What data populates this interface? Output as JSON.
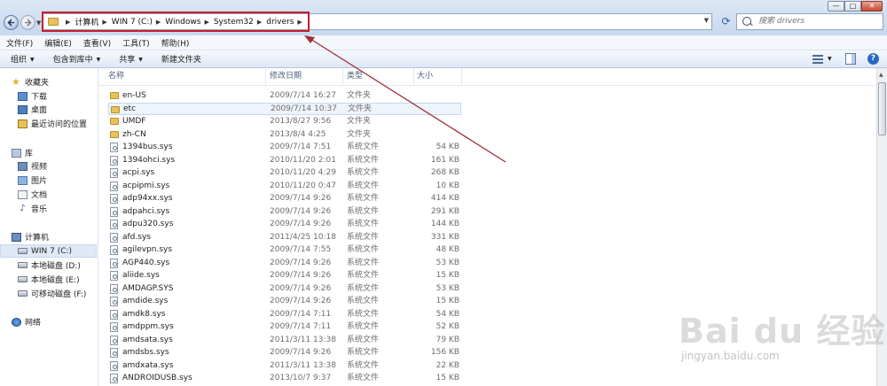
{
  "window": {
    "min_symbol": "—",
    "max_symbol": "□",
    "close_symbol": "✕"
  },
  "address": {
    "segments": [
      "计算机",
      "WIN 7 (C:)",
      "Windows",
      "System32",
      "drivers"
    ]
  },
  "search": {
    "placeholder": "搜索 drivers"
  },
  "menu": [
    "文件(F)",
    "编辑(E)",
    "查看(V)",
    "工具(T)",
    "帮助(H)"
  ],
  "toolbar": {
    "organize": "组织",
    "include_library": "包含到库中",
    "share": "共享",
    "new_folder": "新建文件夹"
  },
  "nav": {
    "favorites": "收藏夹",
    "downloads": "下载",
    "desktop": "桌面",
    "recent": "最近访问的位置",
    "libraries": "库",
    "videos": "视频",
    "pictures": "图片",
    "documents": "文档",
    "music": "音乐",
    "computer": "计算机",
    "drive_c": "WIN 7 (C:)",
    "drive_d": "本地磁盘 (D:)",
    "drive_e": "本地磁盘 (E:)",
    "drive_f": "可移动磁盘 (F:)",
    "network": "网络"
  },
  "columns": {
    "name": "名称",
    "date": "修改日期",
    "type": "类型",
    "size": "大小"
  },
  "files": [
    {
      "name": "en-US",
      "date": "2009/7/14 16:27",
      "type": "文件夹",
      "size": "",
      "kind": "folder"
    },
    {
      "name": "etc",
      "date": "2009/7/14 10:37",
      "type": "文件夹",
      "size": "",
      "kind": "folder"
    },
    {
      "name": "UMDF",
      "date": "2013/8/27 9:56",
      "type": "文件夹",
      "size": "",
      "kind": "folder"
    },
    {
      "name": "zh-CN",
      "date": "2013/8/4 4:25",
      "type": "文件夹",
      "size": "",
      "kind": "folder"
    },
    {
      "name": "1394bus.sys",
      "date": "2009/7/14 7:51",
      "type": "系统文件",
      "size": "54 KB",
      "kind": "sys"
    },
    {
      "name": "1394ohci.sys",
      "date": "2010/11/20 2:01",
      "type": "系统文件",
      "size": "161 KB",
      "kind": "sys"
    },
    {
      "name": "acpi.sys",
      "date": "2010/11/20 4:29",
      "type": "系统文件",
      "size": "268 KB",
      "kind": "sys"
    },
    {
      "name": "acpipmi.sys",
      "date": "2010/11/20 0:47",
      "type": "系统文件",
      "size": "10 KB",
      "kind": "sys"
    },
    {
      "name": "adp94xx.sys",
      "date": "2009/7/14 9:26",
      "type": "系统文件",
      "size": "414 KB",
      "kind": "sys"
    },
    {
      "name": "adpahci.sys",
      "date": "2009/7/14 9:26",
      "type": "系统文件",
      "size": "291 KB",
      "kind": "sys"
    },
    {
      "name": "adpu320.sys",
      "date": "2009/7/14 9:26",
      "type": "系统文件",
      "size": "144 KB",
      "kind": "sys"
    },
    {
      "name": "afd.sys",
      "date": "2011/4/25 10:18",
      "type": "系统文件",
      "size": "331 KB",
      "kind": "sys"
    },
    {
      "name": "agilevpn.sys",
      "date": "2009/7/14 7:55",
      "type": "系统文件",
      "size": "48 KB",
      "kind": "sys"
    },
    {
      "name": "AGP440.sys",
      "date": "2009/7/14 9:26",
      "type": "系统文件",
      "size": "53 KB",
      "kind": "sys"
    },
    {
      "name": "aliide.sys",
      "date": "2009/7/14 9:26",
      "type": "系统文件",
      "size": "15 KB",
      "kind": "sys"
    },
    {
      "name": "AMDAGP.SYS",
      "date": "2009/7/14 9:26",
      "type": "系统文件",
      "size": "53 KB",
      "kind": "sys"
    },
    {
      "name": "amdide.sys",
      "date": "2009/7/14 9:26",
      "type": "系统文件",
      "size": "15 KB",
      "kind": "sys"
    },
    {
      "name": "amdk8.sys",
      "date": "2009/7/14 7:11",
      "type": "系统文件",
      "size": "54 KB",
      "kind": "sys"
    },
    {
      "name": "amdppm.sys",
      "date": "2009/7/14 7:11",
      "type": "系统文件",
      "size": "52 KB",
      "kind": "sys"
    },
    {
      "name": "amdsata.sys",
      "date": "2011/3/11 13:38",
      "type": "系统文件",
      "size": "79 KB",
      "kind": "sys"
    },
    {
      "name": "amdsbs.sys",
      "date": "2009/7/14 9:26",
      "type": "系统文件",
      "size": "156 KB",
      "kind": "sys"
    },
    {
      "name": "amdxata.sys",
      "date": "2011/3/11 13:38",
      "type": "系统文件",
      "size": "22 KB",
      "kind": "sys"
    },
    {
      "name": "ANDROIDUSB.sys",
      "date": "2013/10/7 9:37",
      "type": "系统文件",
      "size": "15 KB",
      "kind": "sys"
    }
  ],
  "watermark": {
    "main": "Bai du 经验",
    "sub": "jingyan.baidu.com"
  },
  "colors": {
    "highlight_box": "#c81e28",
    "annotation_arrow": "#a0303a"
  }
}
